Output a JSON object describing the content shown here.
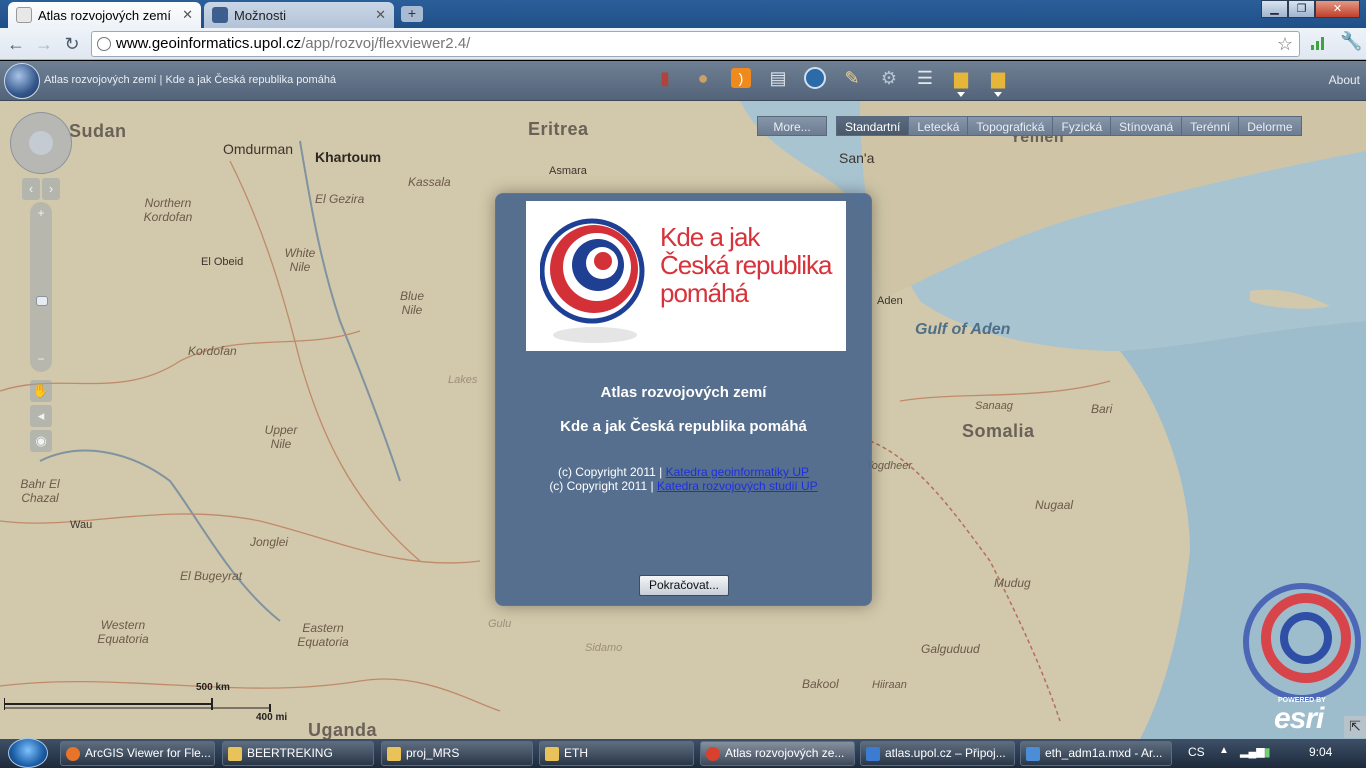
{
  "browser": {
    "tabs": [
      {
        "label": "Atlas rozvojových zemí",
        "active": true
      },
      {
        "label": "Možnosti",
        "active": false
      }
    ],
    "url_host": "www.geoinformatics.upol.cz",
    "url_path": "/app/rozvoj/flexviewer2.4/"
  },
  "app": {
    "title": "Atlas rozvojových zemí | Kde a jak Česká republika pomáhá",
    "about": "About",
    "toolbar_icons": [
      "book-icon",
      "palette-icon",
      "rss-icon",
      "print-icon",
      "measure-icon",
      "edit-icon",
      "gears-icon",
      "list-icon",
      "folder-icon",
      "folder-icon"
    ]
  },
  "basemaps": {
    "more": "More...",
    "items": [
      "Standartní",
      "Letecká",
      "Topografická",
      "Fyzická",
      "Stínovaná",
      "Terénní",
      "Delorme"
    ],
    "selected": "Standartní"
  },
  "map": {
    "labels": {
      "country": [
        "Sudan",
        "Eritrea",
        "Somalia",
        "Uganda",
        "Yemen"
      ],
      "sea": [
        "Gulf of Aden"
      ],
      "cities": [
        "Omdurman",
        "Khartoum",
        "El Obeid",
        "Wau",
        "San'a",
        "Aden",
        "Asmara"
      ],
      "regions": [
        "Northern Kordofan",
        "Kordofan",
        "Kassala",
        "El Gezira",
        "White Nile",
        "Blue Nile",
        "Upper Nile",
        "Bahr El Chazal",
        "Jonglei",
        "El Bugeyrat",
        "Western Equatoria",
        "Eastern Equatoria",
        "Sanaag",
        "Bari",
        "Nugaal",
        "Mudug",
        "Galguduud",
        "Bakool",
        "Hiiraan",
        "Togdheer",
        "Lakes",
        "Gulu",
        "Sidamo"
      ]
    },
    "scale_km": "500 km",
    "scale_mi": "400 mi",
    "esri_powered": "POWERED BY",
    "esri": "esri"
  },
  "splash": {
    "logo_text_1": "Kde a jak",
    "logo_text_2": "Česká republika",
    "logo_text_3": "pomáhá",
    "title": "Atlas rozvojových zemí",
    "subtitle": "Kde a jak Česká republika pomáhá",
    "copy1_prefix": "(c) Copyright 2011 |",
    "copy1_link": "Katedra geoinformatiky UP",
    "copy2_prefix": "(c) Copyright 2011 |",
    "copy2_link": "Katedra rozvojových studií UP",
    "continue": "Pokračovat..."
  },
  "taskbar": {
    "items": [
      {
        "label": "ArcGIS Viewer for Fle...",
        "color": "#e8732a"
      },
      {
        "label": "BEERTREKING",
        "color": "#e9c25a"
      },
      {
        "label": "proj_MRS",
        "color": "#e9c25a"
      },
      {
        "label": "ETH",
        "color": "#e9c25a"
      },
      {
        "label": "Atlas rozvojových ze...",
        "color": "#d9412e"
      },
      {
        "label": "atlas.upol.cz – Připoj...",
        "color": "#3b7bd1"
      },
      {
        "label": "eth_adm1a.mxd - Ar...",
        "color": "#4b8dd6"
      }
    ],
    "lang": "CS",
    "time": "9:04"
  }
}
